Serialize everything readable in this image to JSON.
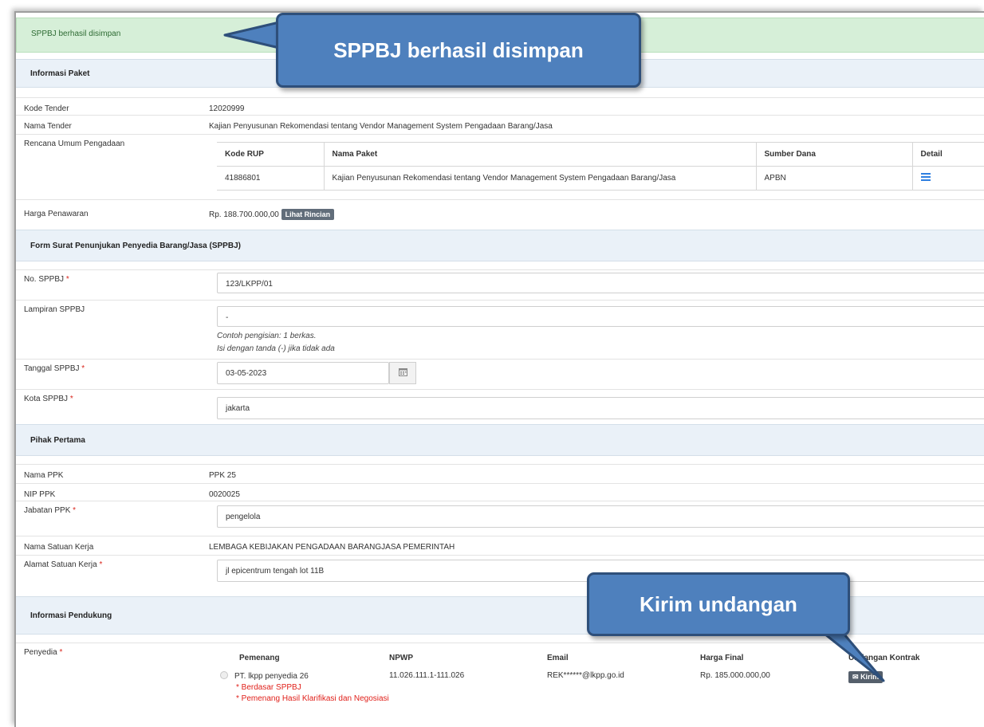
{
  "alert": {
    "message": "SPPBJ berhasil disimpan"
  },
  "sections": {
    "info_paket": "Informasi Paket",
    "form_sppbj": "Form Surat Penunjukan Penyedia Barang/Jasa (SPPBJ)",
    "pihak_pertama": "Pihak Pertama",
    "info_pendukung": "Informasi Pendukung"
  },
  "paket": {
    "kode_tender_label": "Kode Tender",
    "kode_tender": "12020999",
    "nama_tender_label": "Nama Tender",
    "nama_tender": "Kajian Penyusunan Rekomendasi tentang Vendor Management System Pengadaan Barang/Jasa",
    "rup_label": "Rencana Umum Pengadaan",
    "rup_headers": [
      "Kode RUP",
      "Nama Paket",
      "Sumber Dana",
      "Detail"
    ],
    "rup_row": {
      "kode": "41886801",
      "nama": "Kajian Penyusunan Rekomendasi tentang Vendor Management System Pengadaan Barang/Jasa",
      "sumber": "APBN",
      "detail_icon": "list-icon"
    },
    "harga_label": "Harga Penawaran",
    "harga": "Rp. 188.700.000,00",
    "lihat_rincian": "Lihat Rincian"
  },
  "form": {
    "no_sppbj_label": "No. SPPBJ",
    "no_sppbj": "123/LKPP/01",
    "lampiran_label": "Lampiran SPPBJ",
    "lampiran": "-",
    "hint1": "Contoh pengisian: 1 berkas.",
    "hint2": "Isi dengan tanda (-) jika tidak ada",
    "tanggal_label": "Tanggal SPPBJ",
    "tanggal": "03-05-2023",
    "kota_label": "Kota SPPBJ",
    "kota": "jakarta",
    "required_mark": "*"
  },
  "pihak": {
    "nama_ppk_label": "Nama PPK",
    "nama_ppk": "PPK 25",
    "nip_label": "NIP PPK",
    "nip": "0020025",
    "jabatan_label": "Jabatan PPK",
    "jabatan": "pengelola",
    "satker_label": "Nama Satuan Kerja",
    "satker": "LEMBAGA KEBIJAKAN PENGADAAN BARANGJASA PEMERINTAH",
    "alamat_label": "Alamat Satuan Kerja",
    "alamat": "jl epicentrum tengah lot 11B"
  },
  "penyedia": {
    "label": "Penyedia",
    "headers": [
      "Pemenang",
      "NPWP",
      "Email",
      "Harga Final",
      "Undangan Kontrak"
    ],
    "row": {
      "nama": "PT. lkpp penyedia 26",
      "note1": "* Berdasar SPPBJ",
      "note2": "* Pemenang Hasil Klarifikasi dan Negosiasi",
      "npwp": "11.026.111.1-111.026",
      "email": "REK******@lkpp.go.id",
      "harga": "Rp. 185.000.000,00",
      "kirim": "Kirim"
    }
  },
  "callouts": {
    "top": "SPPBJ berhasil disimpan",
    "bottom": "Kirim undangan"
  },
  "colors": {
    "callout": "#4e80bd",
    "alert_bg": "#d6efd8",
    "section_bg": "#eaf1f8",
    "required": "#d9251c"
  }
}
